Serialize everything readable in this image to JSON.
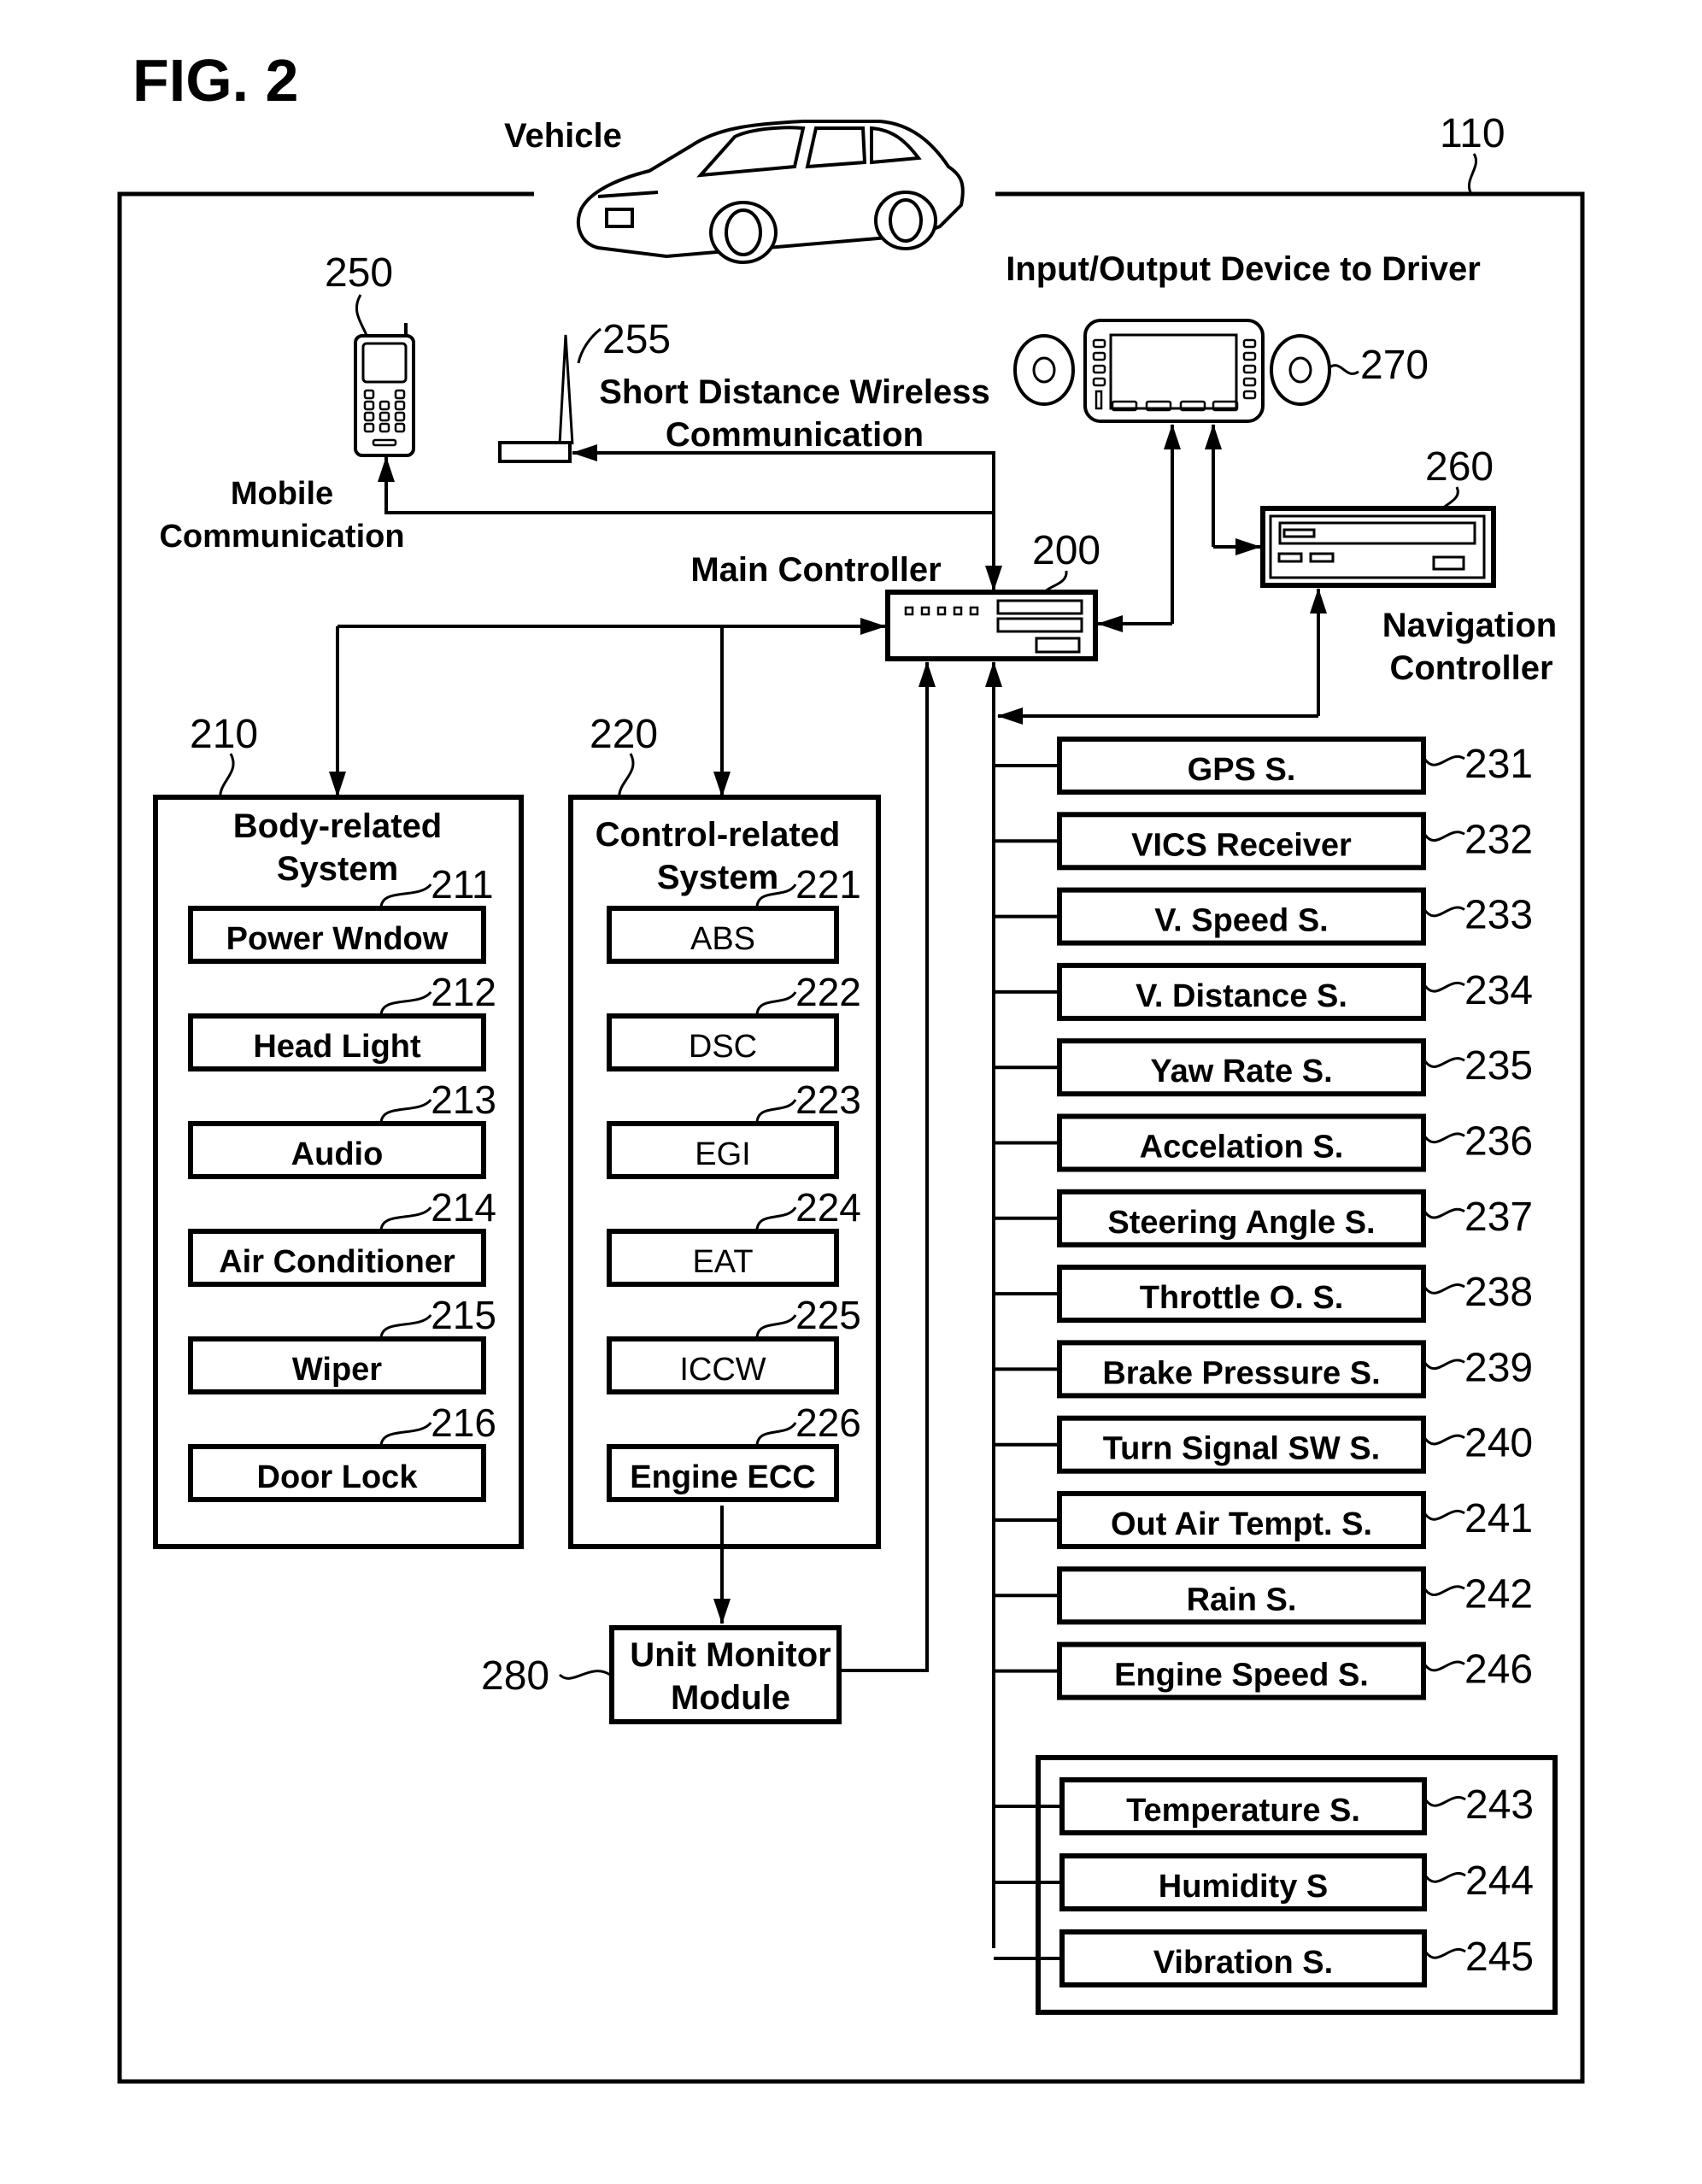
{
  "figure": {
    "title": "FIG. 2",
    "system_ref": "110",
    "vehicle_label": "Vehicle"
  },
  "top_devices": {
    "mobile": {
      "ref": "250",
      "label_line1": "Mobile",
      "label_line2": "Communication"
    },
    "short_range": {
      "ref": "255",
      "label_line1": "Short Distance Wireless",
      "label_line2": "Communication"
    },
    "io_device": {
      "ref": "270",
      "label": "Input/Output Device to Driver"
    },
    "navigation": {
      "ref": "260",
      "label_line1": "Navigation",
      "label_line2": "Controller"
    },
    "main_controller": {
      "ref": "200",
      "label": "Main Controller"
    }
  },
  "body_system": {
    "ref": "210",
    "title_line1": "Body-related",
    "title_line2": "System",
    "items": [
      {
        "ref": "211",
        "label": "Power Wndow"
      },
      {
        "ref": "212",
        "label": "Head Light"
      },
      {
        "ref": "213",
        "label": "Audio"
      },
      {
        "ref": "214",
        "label": "Air Conditioner"
      },
      {
        "ref": "215",
        "label": "Wiper"
      },
      {
        "ref": "216",
        "label": "Door Lock"
      }
    ]
  },
  "control_system": {
    "ref": "220",
    "title_line1": "Control-related",
    "title_line2": "System",
    "items": [
      {
        "ref": "221",
        "label": "ABS"
      },
      {
        "ref": "222",
        "label": "DSC"
      },
      {
        "ref": "223",
        "label": "EGI"
      },
      {
        "ref": "224",
        "label": "EAT"
      },
      {
        "ref": "225",
        "label": "ICCW"
      },
      {
        "ref": "226",
        "label": "Engine ECC"
      }
    ]
  },
  "unit_monitor": {
    "ref": "280",
    "label_line1": "Unit Monitor",
    "label_line2": "Module"
  },
  "sensors": [
    {
      "ref": "231",
      "label": "GPS S."
    },
    {
      "ref": "232",
      "label": "VICS Receiver"
    },
    {
      "ref": "233",
      "label": "V. Speed S."
    },
    {
      "ref": "234",
      "label": "V. Distance S."
    },
    {
      "ref": "235",
      "label": "Yaw Rate S."
    },
    {
      "ref": "236",
      "label": "Accelation  S."
    },
    {
      "ref": "237",
      "label": "Steering Angle S."
    },
    {
      "ref": "238",
      "label": "Throttle O. S."
    },
    {
      "ref": "239",
      "label": "Brake Pressure  S."
    },
    {
      "ref": "240",
      "label": "Turn Signal SW S."
    },
    {
      "ref": "241",
      "label": "Out Air Tempt. S."
    },
    {
      "ref": "242",
      "label": "Rain S."
    },
    {
      "ref": "246",
      "label": "Engine Speed  S."
    }
  ],
  "env_sensors": [
    {
      "ref": "243",
      "label": "Temperature  S."
    },
    {
      "ref": "244",
      "label": "Humidity S"
    },
    {
      "ref": "245",
      "label": "Vibration  S."
    }
  ]
}
